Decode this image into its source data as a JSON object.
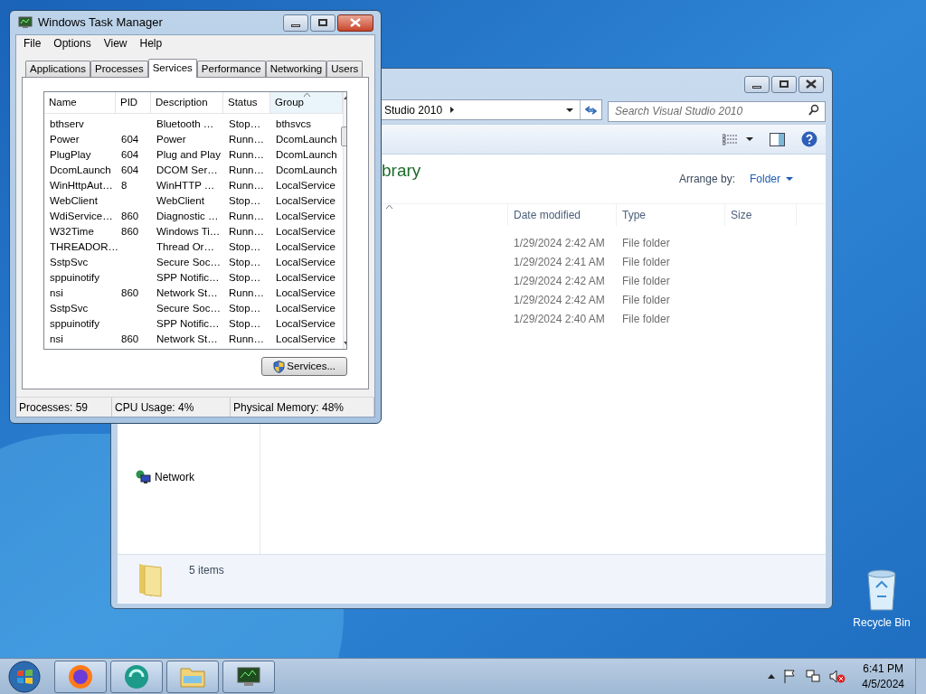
{
  "explorer": {
    "address": "Studio 2010",
    "search": {
      "placeholder": "Search Visual Studio 2010"
    },
    "library_title": "brary",
    "arrange_by": {
      "label": "Arrange by:",
      "value": "Folder"
    },
    "columns": [
      {
        "label": "Date modified"
      },
      {
        "label": "Type"
      },
      {
        "label": "Size"
      }
    ],
    "rows": [
      {
        "date": "1/29/2024 2:42 AM",
        "type": "File folder"
      },
      {
        "date": "1/29/2024 2:41 AM",
        "type": "File folder"
      },
      {
        "date": "1/29/2024 2:42 AM",
        "type": "File folder"
      },
      {
        "date": "1/29/2024 2:42 AM",
        "type": "File folder"
      },
      {
        "date": "1/29/2024 2:40 AM",
        "type": "File folder"
      }
    ],
    "nav": [
      {
        "label": "Network"
      }
    ],
    "status": "5 items"
  },
  "task_manager": {
    "title": "Windows Task Manager",
    "menu": [
      "File",
      "Options",
      "View",
      "Help"
    ],
    "tabs": [
      {
        "label": "Applications",
        "selected": false
      },
      {
        "label": "Processes",
        "selected": false
      },
      {
        "label": "Services",
        "selected": true
      },
      {
        "label": "Performance",
        "selected": false
      },
      {
        "label": "Networking",
        "selected": false
      },
      {
        "label": "Users",
        "selected": false
      }
    ],
    "columns": [
      {
        "label": "Name",
        "sorted": false
      },
      {
        "label": "PID",
        "sorted": false
      },
      {
        "label": "Description",
        "sorted": false
      },
      {
        "label": "Status",
        "sorted": false
      },
      {
        "label": "Group",
        "sorted": true
      }
    ],
    "rows": [
      [
        "bthserv",
        "",
        "Bluetooth …",
        "Stop…",
        "bthsvcs"
      ],
      [
        "Power",
        "604",
        "Power",
        "Runn…",
        "DcomLaunch"
      ],
      [
        "PlugPlay",
        "604",
        "Plug and Play",
        "Runn…",
        "DcomLaunch"
      ],
      [
        "DcomLaunch",
        "604",
        "DCOM Ser…",
        "Runn…",
        "DcomLaunch"
      ],
      [
        "WinHttpAut…",
        "8",
        "WinHTTP …",
        "Runn…",
        "LocalService"
      ],
      [
        "WebClient",
        "",
        "WebClient",
        "Stop…",
        "LocalService"
      ],
      [
        "WdiService…",
        "860",
        "Diagnostic …",
        "Runn…",
        "LocalService"
      ],
      [
        "W32Time",
        "860",
        "Windows Ti…",
        "Runn…",
        "LocalService"
      ],
      [
        "THREADOR…",
        "",
        "Thread Or…",
        "Stop…",
        "LocalService"
      ],
      [
        "SstpSvc",
        "",
        "Secure Soc…",
        "Stop…",
        "LocalService"
      ],
      [
        "sppuinotify",
        "",
        "SPP Notific…",
        "Stop…",
        "LocalService"
      ],
      [
        "nsi",
        "860",
        "Network St…",
        "Runn…",
        "LocalService"
      ],
      [
        "SstpSvc",
        "",
        "Secure Soc…",
        "Stop…",
        "LocalService"
      ],
      [
        "sppuinotify",
        "",
        "SPP Notific…",
        "Stop…",
        "LocalService"
      ],
      [
        "nsi",
        "860",
        "Network St…",
        "Runn…",
        "LocalService"
      ]
    ],
    "services_button": "Services...",
    "status_bar": [
      "Processes: 59",
      "CPU Usage: 4%",
      "Physical Memory: 48%"
    ]
  },
  "desktop": {
    "icons": [
      {
        "label": "Recycle Bin"
      }
    ]
  },
  "taskbar": {
    "clock": {
      "time": "6:41 PM",
      "date": "4/5/2024"
    }
  }
}
